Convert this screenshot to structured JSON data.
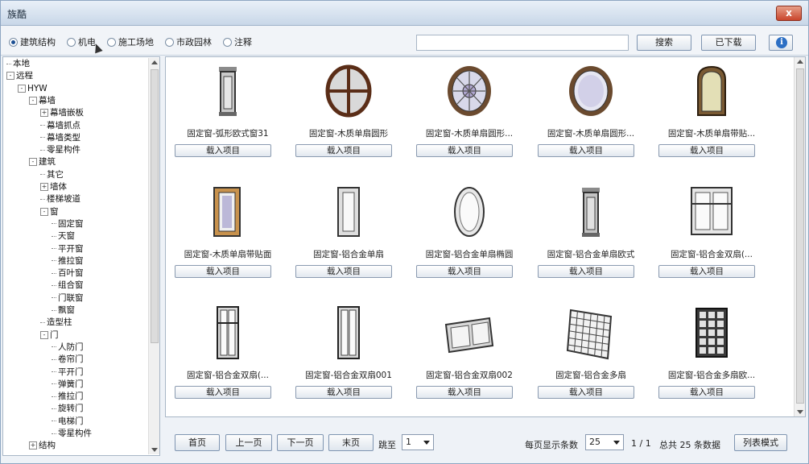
{
  "window": {
    "title": "族酷",
    "close_label": "x"
  },
  "toolbar": {
    "radios": [
      {
        "label": "建筑结构",
        "selected": true
      },
      {
        "label": "机电",
        "selected": false
      },
      {
        "label": "施工场地",
        "selected": false
      },
      {
        "label": "市政园林",
        "selected": false
      },
      {
        "label": "注释",
        "selected": false
      }
    ],
    "search_value": "",
    "search_button": "搜索",
    "downloaded_button": "已下载",
    "info_icon": "i"
  },
  "tree": {
    "items": [
      {
        "label": "本地",
        "level": 0,
        "exp": ""
      },
      {
        "label": "远程",
        "level": 0,
        "exp": "-"
      },
      {
        "label": "HYW",
        "level": 1,
        "exp": "-"
      },
      {
        "label": "幕墙",
        "level": 2,
        "exp": "-"
      },
      {
        "label": "幕墙嵌板",
        "level": 3,
        "exp": "+"
      },
      {
        "label": "幕墙抓点",
        "level": 3,
        "exp": ""
      },
      {
        "label": "幕墙类型",
        "level": 3,
        "exp": ""
      },
      {
        "label": "零星构件",
        "level": 3,
        "exp": ""
      },
      {
        "label": "建筑",
        "level": 2,
        "exp": "-"
      },
      {
        "label": "其它",
        "level": 3,
        "exp": ""
      },
      {
        "label": "墙体",
        "level": 3,
        "exp": "+"
      },
      {
        "label": "楼梯坡道",
        "level": 3,
        "exp": ""
      },
      {
        "label": "窗",
        "level": 3,
        "exp": "-"
      },
      {
        "label": "固定窗",
        "level": 4,
        "exp": ""
      },
      {
        "label": "天窗",
        "level": 4,
        "exp": ""
      },
      {
        "label": "平开窗",
        "level": 4,
        "exp": ""
      },
      {
        "label": "推拉窗",
        "level": 4,
        "exp": ""
      },
      {
        "label": "百叶窗",
        "level": 4,
        "exp": ""
      },
      {
        "label": "组合窗",
        "level": 4,
        "exp": ""
      },
      {
        "label": "门联窗",
        "level": 4,
        "exp": ""
      },
      {
        "label": "飘窗",
        "level": 4,
        "exp": ""
      },
      {
        "label": "造型柱",
        "level": 3,
        "exp": ""
      },
      {
        "label": "门",
        "level": 3,
        "exp": "-"
      },
      {
        "label": "人防门",
        "level": 4,
        "exp": ""
      },
      {
        "label": "卷帘门",
        "level": 4,
        "exp": ""
      },
      {
        "label": "平开门",
        "level": 4,
        "exp": ""
      },
      {
        "label": "弹簧门",
        "level": 4,
        "exp": ""
      },
      {
        "label": "推拉门",
        "level": 4,
        "exp": ""
      },
      {
        "label": "旋转门",
        "level": 4,
        "exp": ""
      },
      {
        "label": "电梯门",
        "level": 4,
        "exp": ""
      },
      {
        "label": "零星构件",
        "level": 4,
        "exp": ""
      },
      {
        "label": "结构",
        "level": 2,
        "exp": "+"
      }
    ]
  },
  "items": [
    {
      "name": "固定窗-弧形欧式窗31",
      "load": "载入项目",
      "icon": "arched-euro-window-icon"
    },
    {
      "name": "固定窗-木质单扇圆形",
      "load": "载入项目",
      "icon": "round-cross-window-icon"
    },
    {
      "name": "固定窗-木质单扇圆形...",
      "load": "载入项目",
      "icon": "round-decor-window-icon"
    },
    {
      "name": "固定窗-木质单扇圆形...",
      "load": "载入项目",
      "icon": "round-plain-window-icon"
    },
    {
      "name": "固定窗-木质单扇带贴...",
      "load": "载入项目",
      "icon": "arched-wood-window-icon"
    },
    {
      "name": "固定窗-木质单扇带贴面",
      "load": "载入项目",
      "icon": "wood-trim-window-icon"
    },
    {
      "name": "固定窗-铝合金单扇",
      "load": "载入项目",
      "icon": "aluminum-single-window-icon"
    },
    {
      "name": "固定窗-铝合金单扇椭圆",
      "load": "载入项目",
      "icon": "oval-window-icon"
    },
    {
      "name": "固定窗-铝合金单扇欧式",
      "load": "载入项目",
      "icon": "euro-aluminum-window-icon"
    },
    {
      "name": "固定窗-铝合金双扇(...",
      "load": "载入项目",
      "icon": "double-pane-window-icon"
    },
    {
      "name": "固定窗-铝合金双扇(...",
      "load": "载入项目",
      "icon": "tall-double-window-icon"
    },
    {
      "name": "固定窗-铝合金双扇001",
      "load": "载入项目",
      "icon": "double-sash-window-icon"
    },
    {
      "name": "固定窗-铝合金双扇002",
      "load": "载入项目",
      "icon": "horizontal-double-window-icon"
    },
    {
      "name": "固定窗-铝合金多扇",
      "load": "载入项目",
      "icon": "grid-multi-window-icon"
    },
    {
      "name": "固定窗-铝合金多扇欧...",
      "load": "载入项目",
      "icon": "dark-grid-window-icon"
    }
  ],
  "pager": {
    "first": "首页",
    "prev": "上一页",
    "next": "下一页",
    "last": "末页",
    "goto_label": "跳至",
    "goto_value": "1",
    "per_page_label": "每页显示条数",
    "per_page_value": "25",
    "page_status": "1 / 1",
    "total_text": "总共 25 条数据",
    "list_mode": "列表模式"
  }
}
